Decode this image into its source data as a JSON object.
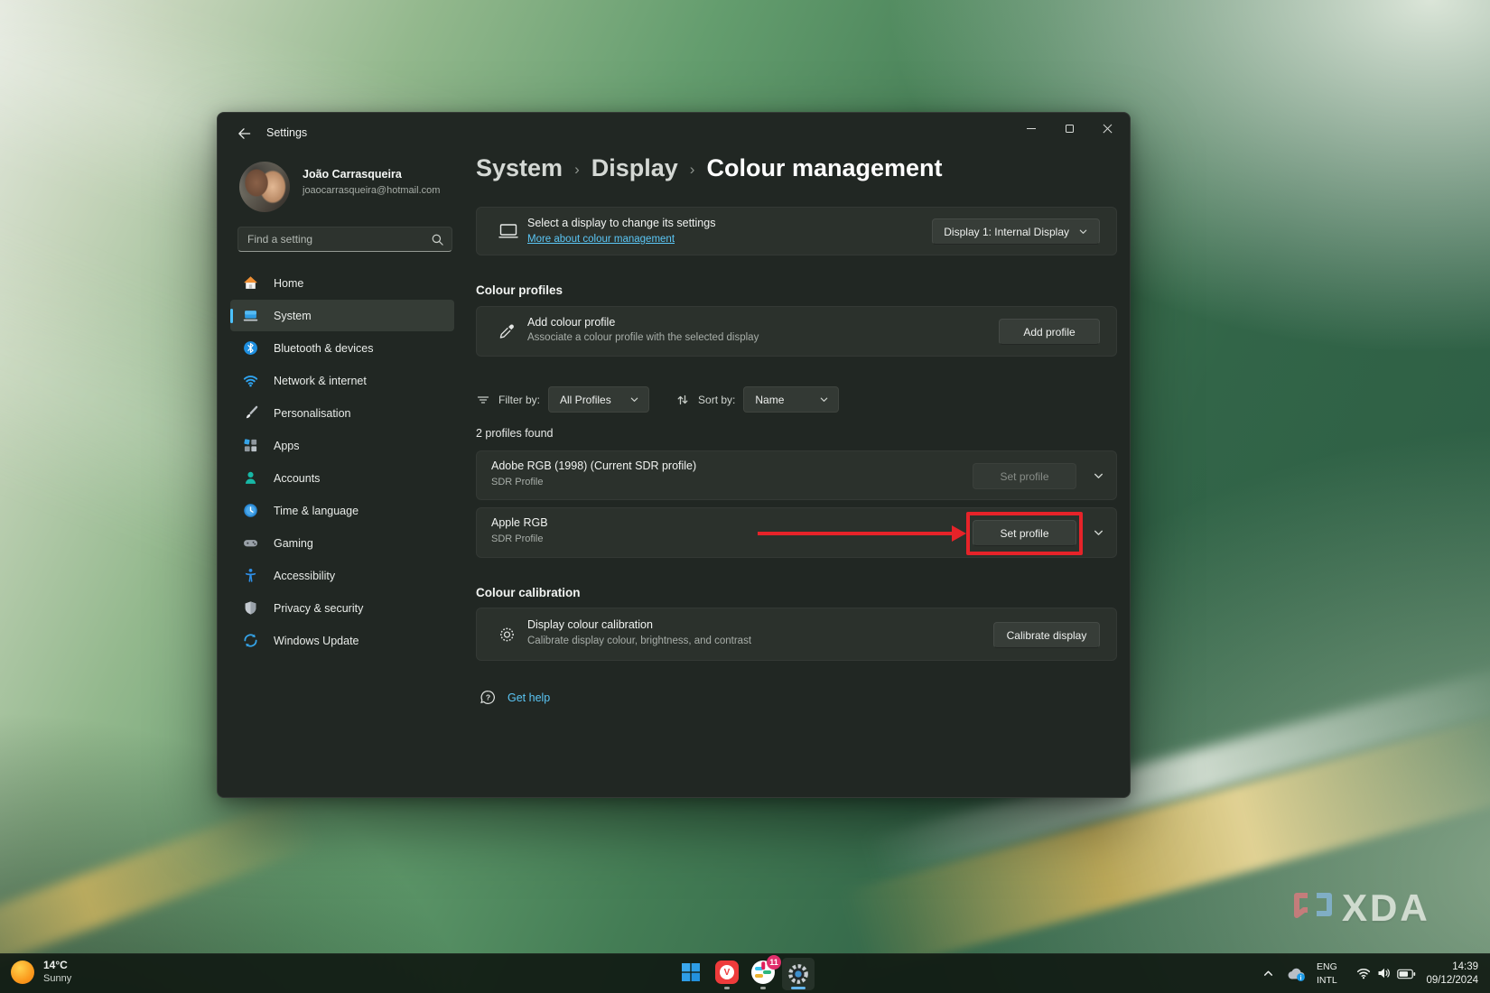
{
  "colors": {
    "accent": "#4CC2FF",
    "annotation_red": "#E62329",
    "link_blue": "#5BC6F5"
  },
  "titlebar": {
    "title": "Settings"
  },
  "user": {
    "name": "João Carrasqueira",
    "email": "joaocarrasqueira@hotmail.com"
  },
  "search": {
    "placeholder": "Find a setting"
  },
  "sidebar": {
    "items": [
      {
        "label": "Home",
        "icon": "home-icon"
      },
      {
        "label": "System",
        "icon": "system-icon",
        "selected": true
      },
      {
        "label": "Bluetooth & devices",
        "icon": "bluetooth-icon"
      },
      {
        "label": "Network & internet",
        "icon": "network-icon"
      },
      {
        "label": "Personalisation",
        "icon": "personalisation-icon"
      },
      {
        "label": "Apps",
        "icon": "apps-icon"
      },
      {
        "label": "Accounts",
        "icon": "accounts-icon"
      },
      {
        "label": "Time & language",
        "icon": "time-language-icon"
      },
      {
        "label": "Gaming",
        "icon": "gaming-icon"
      },
      {
        "label": "Accessibility",
        "icon": "accessibility-icon"
      },
      {
        "label": "Privacy & security",
        "icon": "privacy-icon"
      },
      {
        "label": "Windows Update",
        "icon": "windows-update-icon"
      }
    ]
  },
  "breadcrumb": {
    "items": [
      "System",
      "Display",
      "Colour management"
    ]
  },
  "display_card": {
    "title": "Select a display to change its settings",
    "link": "More about colour management",
    "selector": "Display 1: Internal Display"
  },
  "profiles_section": {
    "heading": "Colour profiles",
    "add_title": "Add colour profile",
    "add_desc": "Associate a colour profile with the selected display",
    "add_button": "Add profile",
    "filter_label": "Filter by:",
    "filter_value": "All Profiles",
    "sort_label": "Sort by:",
    "sort_value": "Name",
    "result_count": "2 profiles found",
    "rows": [
      {
        "name": "Adobe RGB (1998) (Current SDR profile)",
        "type": "SDR Profile",
        "action": "Set profile",
        "disabled": true
      },
      {
        "name": "Apple RGB",
        "type": "SDR Profile",
        "action": "Set profile",
        "disabled": false,
        "annotated": true
      }
    ]
  },
  "calibration_section": {
    "heading": "Colour calibration",
    "title": "Display colour calibration",
    "desc": "Calibrate display colour, brightness, and contrast",
    "button": "Calibrate display"
  },
  "help_link": "Get help",
  "taskbar": {
    "weather_temp": "14°C",
    "weather_condition": "Sunny",
    "slack_badge": "11",
    "lang_top": "ENG",
    "lang_bottom": "INTL",
    "time": "14:39",
    "date": "09/12/2024"
  },
  "watermark_text": "XDA"
}
